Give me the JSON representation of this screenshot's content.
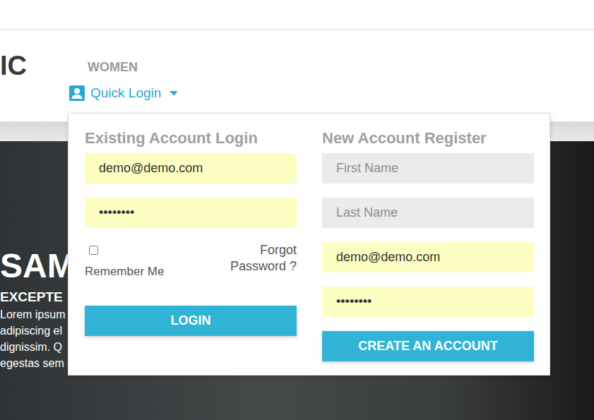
{
  "logo": "IC",
  "menu": [
    {
      "label": "WOMEN"
    }
  ],
  "quick_login": {
    "label": "Quick Login",
    "expanded": true
  },
  "login": {
    "title": "Existing Account Login",
    "email": "demo@demo.com",
    "password": "••••••••",
    "remember": {
      "label": "Remember Me",
      "checked": false
    },
    "forgot": "Forgot Password ?",
    "button": "LOGIN"
  },
  "register": {
    "title": "New Account Register",
    "first_name": {
      "placeholder": "First Name"
    },
    "last_name": {
      "placeholder": "Last Name"
    },
    "email": "demo@demo.com",
    "password": "••••••••",
    "button": "CREATE AN ACCOUNT"
  },
  "hero": {
    "title": "SAM",
    "subtitle": "EXCEPTE",
    "lines": [
      "Lorem ipsum",
      "adipiscing el",
      "dignissim. Q",
      "egestas sem elit"
    ]
  }
}
